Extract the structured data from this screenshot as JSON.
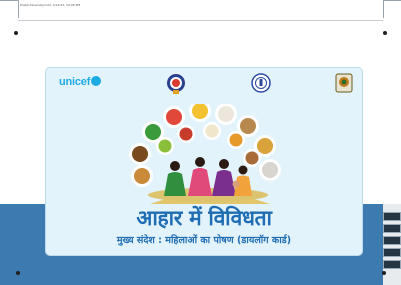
{
  "file_label": "Poster-Diversity.indd, 3/12/23, 10:06 PM",
  "card": {
    "logo_text": "unicef",
    "title": "आहार में विविधता",
    "subtitle": "मुख्य संदेश : महिलाओं का पोषण (डायलॉग कार्ड)"
  },
  "icons": {
    "left_emblem": "state-emblem-icon",
    "middle_emblem": "government-seal-icon",
    "right_emblem": "department-logo-icon"
  },
  "colors": {
    "band_blue": "#3d7ab0",
    "card_bg": "#e3f3fb",
    "title_blue": "#1f6db3",
    "unicef_cyan": "#1cabe2"
  }
}
